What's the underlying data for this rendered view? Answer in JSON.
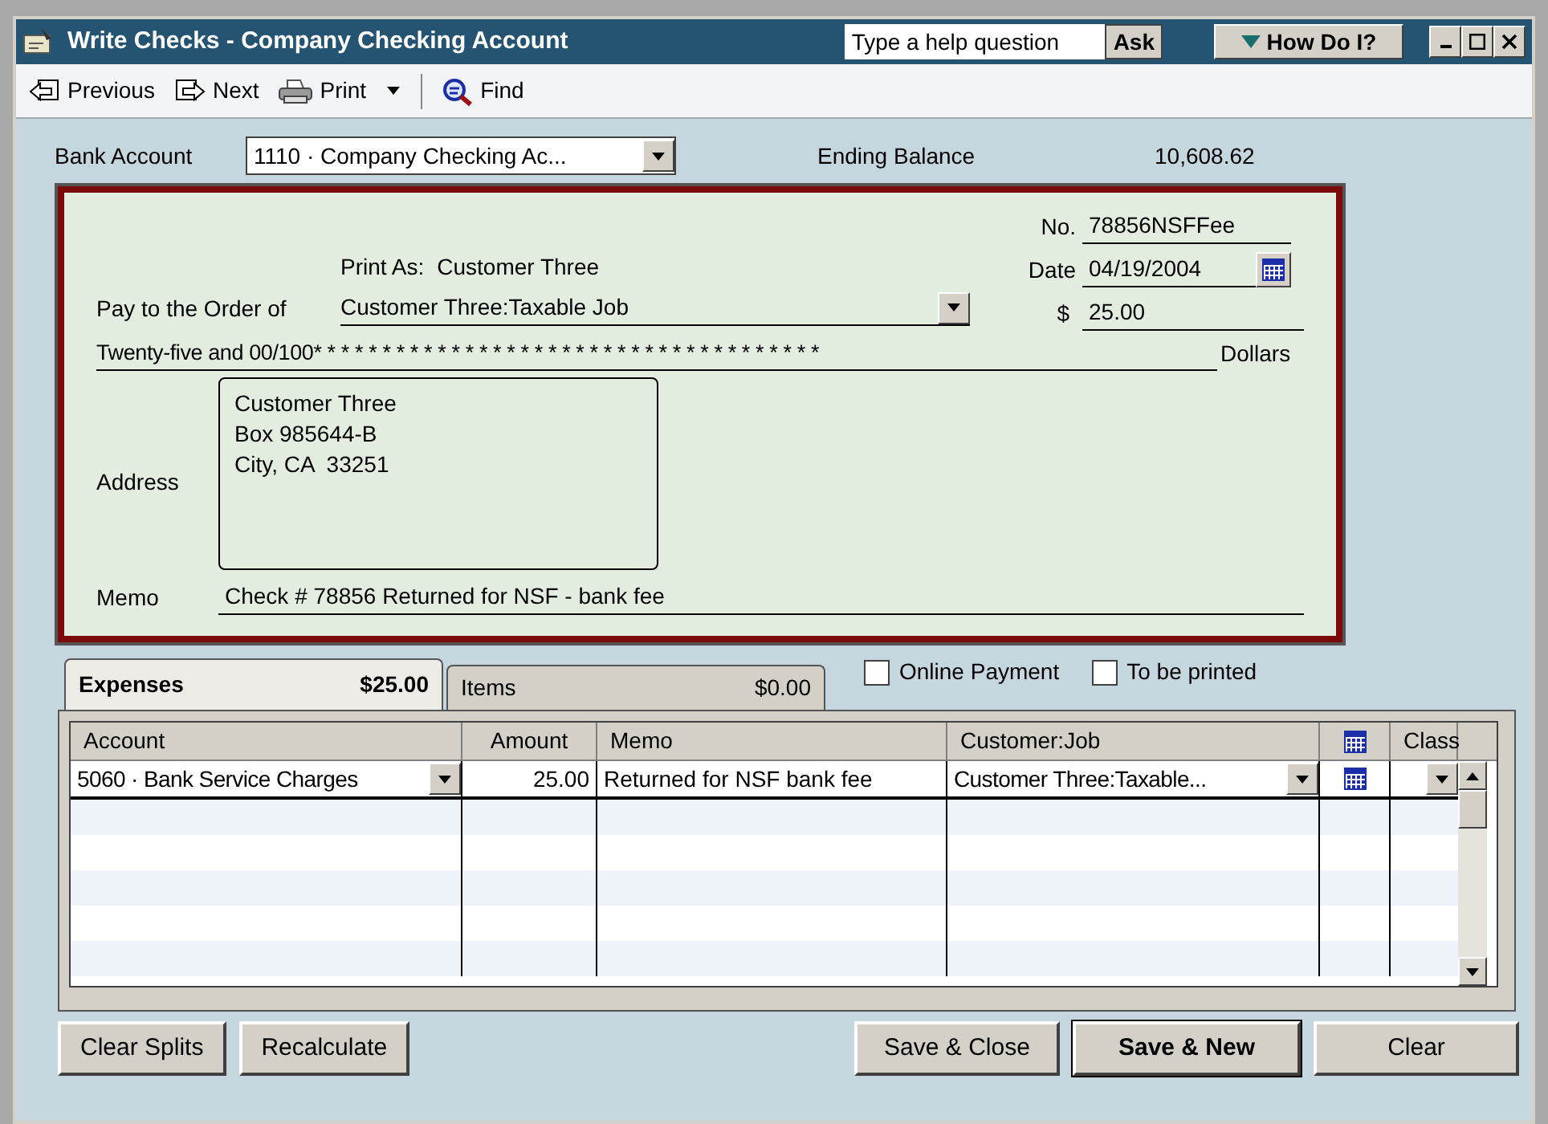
{
  "window": {
    "title": "Write Checks - Company Checking Account",
    "help_placeholder": "Type a help question",
    "ask_button": "Ask",
    "how_do_i": "How Do I?"
  },
  "toolbar": [
    {
      "kind": "previous",
      "label": "Previous"
    },
    {
      "kind": "next",
      "label": "Next"
    },
    {
      "kind": "print",
      "label": "Print"
    },
    {
      "kind": "find",
      "label": "Find"
    }
  ],
  "bank_account": {
    "label": "Bank Account",
    "value": "1110 · Company Checking Ac..."
  },
  "ending_balance": {
    "label": "Ending Balance",
    "value": "10,608.62"
  },
  "check": {
    "no_label": "No.",
    "number": "78856NSFFee",
    "date_label": "Date",
    "date": "04/19/2004",
    "dollar_label": "$",
    "amount": "25.00",
    "print_as_label": "Print As:",
    "print_as": "Customer Three",
    "pay_label": "Pay to the Order of",
    "payee": "Customer Three:Taxable Job",
    "amount_words": "Twenty-five and 00/100* * * * * * * * * * * * * * * * * * * * * * * * * * * * * * * * * * * * *",
    "dollars_label": "Dollars",
    "address_label": "Address",
    "address": [
      "Customer Three",
      "Box 985644-B",
      "City, CA  33251"
    ],
    "memo_label": "Memo",
    "memo": "Check # 78856 Returned for NSF - bank fee"
  },
  "tabs": [
    {
      "label": "Expenses",
      "amount": "$25.00",
      "selected": true
    },
    {
      "label": "Items",
      "amount": "$0.00",
      "selected": false
    }
  ],
  "checkboxes": [
    {
      "label": "Online Payment",
      "checked": false
    },
    {
      "label": "To be printed",
      "checked": false
    }
  ],
  "table": {
    "columns": [
      {
        "kind": "text",
        "label": "Account"
      },
      {
        "kind": "text",
        "label": "Amount"
      },
      {
        "kind": "text",
        "label": "Memo"
      },
      {
        "kind": "text",
        "label": "Customer:Job"
      },
      {
        "kind": "icon"
      },
      {
        "kind": "text",
        "label": "Class"
      }
    ],
    "rows": [
      {
        "account": "5060 · Bank Service Charges",
        "amount": "25.00",
        "memo": "Returned for NSF bank fee",
        "customer_job": "Customer Three:Taxable..."
      }
    ]
  },
  "buttons_left": [
    {
      "label": "Clear Splits",
      "default": false
    },
    {
      "label": "Recalculate",
      "default": false
    }
  ],
  "buttons_right": [
    {
      "label": "Save & Close",
      "default": false
    },
    {
      "label": "Save & New",
      "default": true
    },
    {
      "label": "Clear",
      "default": false
    }
  ]
}
